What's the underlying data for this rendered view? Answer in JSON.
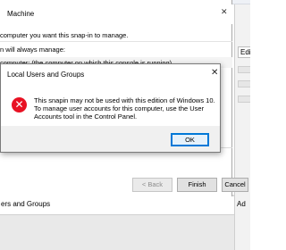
{
  "background": {
    "top_text": "Machine",
    "right_tab_label": "Edi",
    "right_add_label": "Ad",
    "bottom_item": "ers and Groups"
  },
  "wizard": {
    "title": "Machine",
    "close_glyph": "✕",
    "instruction": "computer you want this snap-in to manage.",
    "manage_line": "n will always manage:",
    "radio_label": "computer:  (the computer on which this console is running)",
    "buttons": {
      "back": "< Back",
      "finish": "Finish",
      "cancel": "Cancel"
    }
  },
  "message_box": {
    "title": "Local Users and Groups",
    "close_glyph": "✕",
    "icon": "error-icon",
    "icon_glyph": "✕",
    "line1": "This snapin may not be used with this edition of Windows 10.",
    "line2": "To manage user accounts for this computer, use the User Accounts tool in the Control Panel.",
    "ok_label": "OK"
  },
  "colors": {
    "error_red": "#e81123",
    "accent_blue": "#0078d7",
    "footer_gray": "#f0f0f0"
  }
}
